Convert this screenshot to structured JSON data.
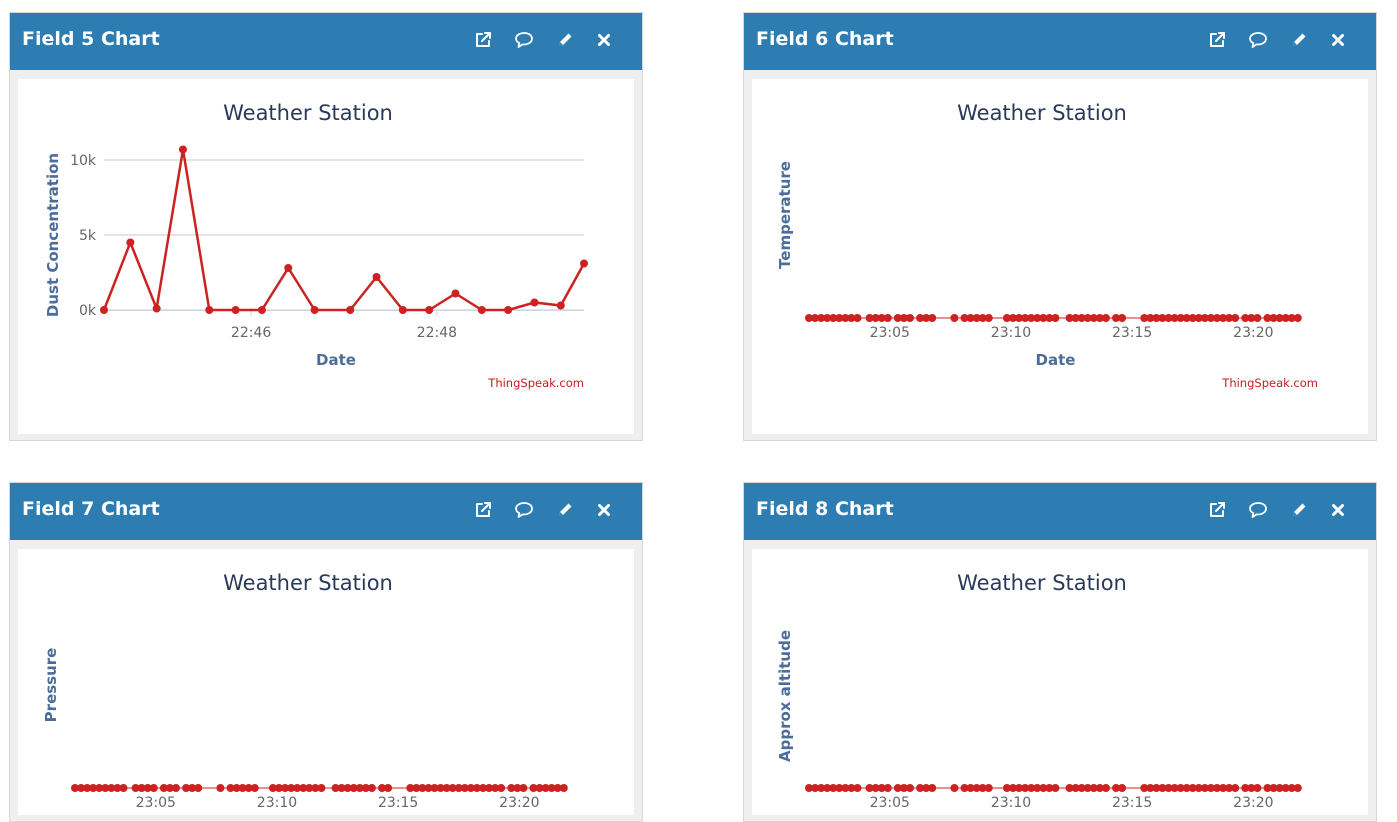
{
  "colors": {
    "header": "#2d7db3",
    "series": "#cc2222",
    "grid": "#c8c8c8"
  },
  "icons": [
    "external-link-icon",
    "comment-icon",
    "pencil-icon",
    "close-icon"
  ],
  "widgets": [
    {
      "title": "Field 5 Chart",
      "chart_data": {
        "type": "line",
        "title": "Weather Station",
        "xlabel": "Date",
        "ylabel": "Dust Concentration",
        "credit": "ThingSpeak.com",
        "x_ticks": [
          "22:46",
          "22:48"
        ],
        "y_ticks": [
          "0k",
          "5k",
          "10k"
        ],
        "ylim": [
          0,
          10000
        ],
        "xlim": [
          "22:44:25",
          "22:49:35"
        ],
        "grid": true,
        "series": [
          {
            "x": [
              "22:44:25",
              "22:44:42",
              "22:44:59",
              "22:45:16",
              "22:45:33",
              "22:45:50",
              "22:46:07",
              "22:46:24",
              "22:46:41",
              "22:47:04",
              "22:47:21",
              "22:47:38",
              "22:47:55",
              "22:48:12",
              "22:48:29",
              "22:48:46",
              "22:49:03",
              "22:49:20",
              "22:49:35"
            ],
            "values": [
              0,
              4500,
              100,
              10700,
              0,
              0,
              0,
              2800,
              0,
              0,
              2200,
              0,
              0,
              1100,
              0,
              0,
              500,
              300,
              3100
            ]
          }
        ]
      }
    },
    {
      "title": "Field 6 Chart",
      "chart_data": {
        "type": "scatter",
        "title": "Weather Station",
        "xlabel": "Date",
        "ylabel": "Temperature",
        "credit": "ThingSpeak.com",
        "x_ticks": [
          "23:05",
          "23:10",
          "23:15",
          "23:20"
        ],
        "xlim": [
          "23:01:40",
          "23:22:40"
        ],
        "grid": false,
        "series": [
          {
            "x": [
              "23:01:40",
              "23:01:55",
              "23:02:10",
              "23:02:25",
              "23:02:40",
              "23:02:55",
              "23:03:10",
              "23:03:25",
              "23:03:40",
              "23:04:10",
              "23:04:25",
              "23:04:40",
              "23:04:55",
              "23:05:20",
              "23:05:35",
              "23:05:50",
              "23:06:15",
              "23:06:30",
              "23:06:45",
              "23:07:40",
              "23:08:05",
              "23:08:20",
              "23:08:35",
              "23:08:50",
              "23:09:05",
              "23:09:50",
              "23:10:05",
              "23:10:20",
              "23:10:35",
              "23:10:50",
              "23:11:05",
              "23:11:20",
              "23:11:35",
              "23:11:50",
              "23:12:25",
              "23:12:40",
              "23:12:55",
              "23:13:10",
              "23:13:25",
              "23:13:40",
              "23:13:55",
              "23:14:20",
              "23:14:35",
              "23:15:30",
              "23:15:45",
              "23:16:00",
              "23:16:15",
              "23:16:30",
              "23:16:45",
              "23:17:00",
              "23:17:15",
              "23:17:30",
              "23:17:45",
              "23:18:00",
              "23:18:15",
              "23:18:30",
              "23:18:45",
              "23:19:00",
              "23:19:15",
              "23:19:40",
              "23:19:55",
              "23:20:10",
              "23:20:35",
              "23:20:50",
              "23:21:05",
              "23:21:20",
              "23:21:35",
              "23:21:50"
            ],
            "values": [
              0,
              0,
              0,
              0,
              0,
              0,
              0,
              0,
              0,
              0,
              0,
              0,
              0,
              0,
              0,
              0,
              0,
              0,
              0,
              0,
              0,
              0,
              0,
              0,
              0,
              0,
              0,
              0,
              0,
              0,
              0,
              0,
              0,
              0,
              0,
              0,
              0,
              0,
              0,
              0,
              0,
              0,
              0,
              0,
              0,
              0,
              0,
              0,
              0,
              0,
              0,
              0,
              0,
              0,
              0,
              0,
              0,
              0,
              0,
              0,
              0,
              0,
              0,
              0,
              0,
              0,
              0,
              0
            ]
          }
        ]
      }
    },
    {
      "title": "Field 7 Chart",
      "chart_data": {
        "type": "scatter",
        "title": "Weather Station",
        "xlabel": "",
        "ylabel": "Pressure",
        "credit": "",
        "x_ticks": [
          "23:05",
          "23:10",
          "23:15",
          "23:20"
        ],
        "xlim": [
          "23:01:40",
          "23:22:40"
        ],
        "grid": false,
        "series": [
          {
            "x": [
              "23:01:40",
              "23:01:55",
              "23:02:10",
              "23:02:25",
              "23:02:40",
              "23:02:55",
              "23:03:10",
              "23:03:25",
              "23:03:40",
              "23:04:10",
              "23:04:25",
              "23:04:40",
              "23:04:55",
              "23:05:20",
              "23:05:35",
              "23:05:50",
              "23:06:15",
              "23:06:30",
              "23:06:45",
              "23:07:40",
              "23:08:05",
              "23:08:20",
              "23:08:35",
              "23:08:50",
              "23:09:05",
              "23:09:50",
              "23:10:05",
              "23:10:20",
              "23:10:35",
              "23:10:50",
              "23:11:05",
              "23:11:20",
              "23:11:35",
              "23:11:50",
              "23:12:25",
              "23:12:40",
              "23:12:55",
              "23:13:10",
              "23:13:25",
              "23:13:40",
              "23:13:55",
              "23:14:20",
              "23:14:35",
              "23:15:30",
              "23:15:45",
              "23:16:00",
              "23:16:15",
              "23:16:30",
              "23:16:45",
              "23:17:00",
              "23:17:15",
              "23:17:30",
              "23:17:45",
              "23:18:00",
              "23:18:15",
              "23:18:30",
              "23:18:45",
              "23:19:00",
              "23:19:15",
              "23:19:40",
              "23:19:55",
              "23:20:10",
              "23:20:35",
              "23:20:50",
              "23:21:05",
              "23:21:20",
              "23:21:35",
              "23:21:50"
            ],
            "values": [
              0,
              0,
              0,
              0,
              0,
              0,
              0,
              0,
              0,
              0,
              0,
              0,
              0,
              0,
              0,
              0,
              0,
              0,
              0,
              0,
              0,
              0,
              0,
              0,
              0,
              0,
              0,
              0,
              0,
              0,
              0,
              0,
              0,
              0,
              0,
              0,
              0,
              0,
              0,
              0,
              0,
              0,
              0,
              0,
              0,
              0,
              0,
              0,
              0,
              0,
              0,
              0,
              0,
              0,
              0,
              0,
              0,
              0,
              0,
              0,
              0,
              0,
              0,
              0,
              0,
              0,
              0,
              0
            ]
          }
        ]
      }
    },
    {
      "title": "Field 8 Chart",
      "chart_data": {
        "type": "scatter",
        "title": "Weather Station",
        "xlabel": "",
        "ylabel": "Approx altitude",
        "credit": "",
        "x_ticks": [
          "23:05",
          "23:10",
          "23:15",
          "23:20"
        ],
        "xlim": [
          "23:01:40",
          "23:22:40"
        ],
        "grid": false,
        "series": [
          {
            "x": [
              "23:01:40",
              "23:01:55",
              "23:02:10",
              "23:02:25",
              "23:02:40",
              "23:02:55",
              "23:03:10",
              "23:03:25",
              "23:03:40",
              "23:04:10",
              "23:04:25",
              "23:04:40",
              "23:04:55",
              "23:05:20",
              "23:05:35",
              "23:05:50",
              "23:06:15",
              "23:06:30",
              "23:06:45",
              "23:07:40",
              "23:08:05",
              "23:08:20",
              "23:08:35",
              "23:08:50",
              "23:09:05",
              "23:09:50",
              "23:10:05",
              "23:10:20",
              "23:10:35",
              "23:10:50",
              "23:11:05",
              "23:11:20",
              "23:11:35",
              "23:11:50",
              "23:12:25",
              "23:12:40",
              "23:12:55",
              "23:13:10",
              "23:13:25",
              "23:13:40",
              "23:13:55",
              "23:14:20",
              "23:14:35",
              "23:15:30",
              "23:15:45",
              "23:16:00",
              "23:16:15",
              "23:16:30",
              "23:16:45",
              "23:17:00",
              "23:17:15",
              "23:17:30",
              "23:17:45",
              "23:18:00",
              "23:18:15",
              "23:18:30",
              "23:18:45",
              "23:19:00",
              "23:19:15",
              "23:19:40",
              "23:19:55",
              "23:20:10",
              "23:20:35",
              "23:20:50",
              "23:21:05",
              "23:21:20",
              "23:21:35",
              "23:21:50"
            ],
            "values": [
              0,
              0,
              0,
              0,
              0,
              0,
              0,
              0,
              0,
              0,
              0,
              0,
              0,
              0,
              0,
              0,
              0,
              0,
              0,
              0,
              0,
              0,
              0,
              0,
              0,
              0,
              0,
              0,
              0,
              0,
              0,
              0,
              0,
              0,
              0,
              0,
              0,
              0,
              0,
              0,
              0,
              0,
              0,
              0,
              0,
              0,
              0,
              0,
              0,
              0,
              0,
              0,
              0,
              0,
              0,
              0,
              0,
              0,
              0,
              0,
              0,
              0,
              0,
              0,
              0,
              0,
              0,
              0
            ]
          }
        ]
      }
    }
  ]
}
